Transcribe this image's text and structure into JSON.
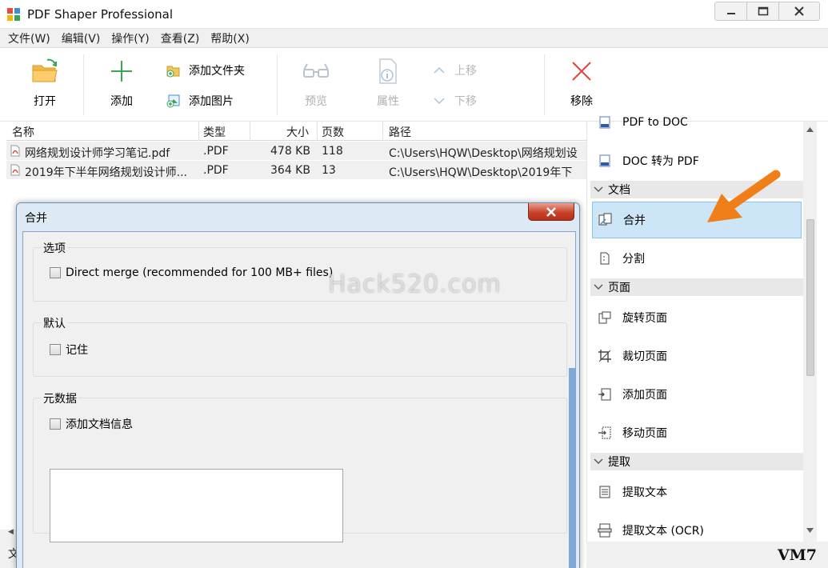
{
  "window": {
    "title": "PDF Shaper Professional"
  },
  "menu": [
    "文件(W)",
    "编辑(V)",
    "操作(Y)",
    "查看(Z)",
    "帮助(X)"
  ],
  "toolbar": {
    "open": "打开",
    "add": "添加",
    "add_folder": "添加文件夹",
    "add_image": "添加图片",
    "preview": "预览",
    "properties": "属性",
    "move_up": "上移",
    "move_down": "下移",
    "remove": "移除"
  },
  "filelist": {
    "columns": [
      "名称",
      "类型",
      "大小",
      "页数",
      "路径"
    ],
    "rows": [
      {
        "name": "网络规划设计师学习笔记.pdf",
        "type": ".PDF",
        "size": "478 KB",
        "pages": "118",
        "path": "C:\\Users\\HQW\\Desktop\\网络规划设"
      },
      {
        "name": "2019年下半年网络规划设计师...",
        "type": ".PDF",
        "size": "364 KB",
        "pages": "13",
        "path": "C:\\Users\\HQW\\Desktop\\2019年下"
      }
    ]
  },
  "dialog": {
    "title": "合并",
    "groups": {
      "options": {
        "title": "选项",
        "checkbox": "Direct merge (recommended for 100 MB+ files)"
      },
      "defaults": {
        "title": "默认",
        "checkbox": "记住"
      },
      "metadata": {
        "title": "元数据",
        "checkbox": "添加文档信息"
      }
    }
  },
  "watermark": "Hack520.com",
  "rpanel": {
    "items_top": [
      "PDF to DOC",
      "DOC 转为 PDF"
    ],
    "sections": {
      "document": {
        "title": "文档",
        "items": [
          "合并",
          "分割"
        ]
      },
      "page": {
        "title": "页面",
        "items": [
          "旋转页面",
          "裁切页面",
          "添加页面",
          "移动页面"
        ]
      },
      "extract": {
        "title": "提取",
        "items": [
          "提取文本",
          "提取文本 (OCR)"
        ]
      }
    }
  },
  "bottom": {
    "status_text": "文",
    "brand": "VM7"
  },
  "colors": {
    "selected_bg": "#cde6f7",
    "orange_arrow": "#f07f1a",
    "dialog_frame": "#dde9f5"
  }
}
